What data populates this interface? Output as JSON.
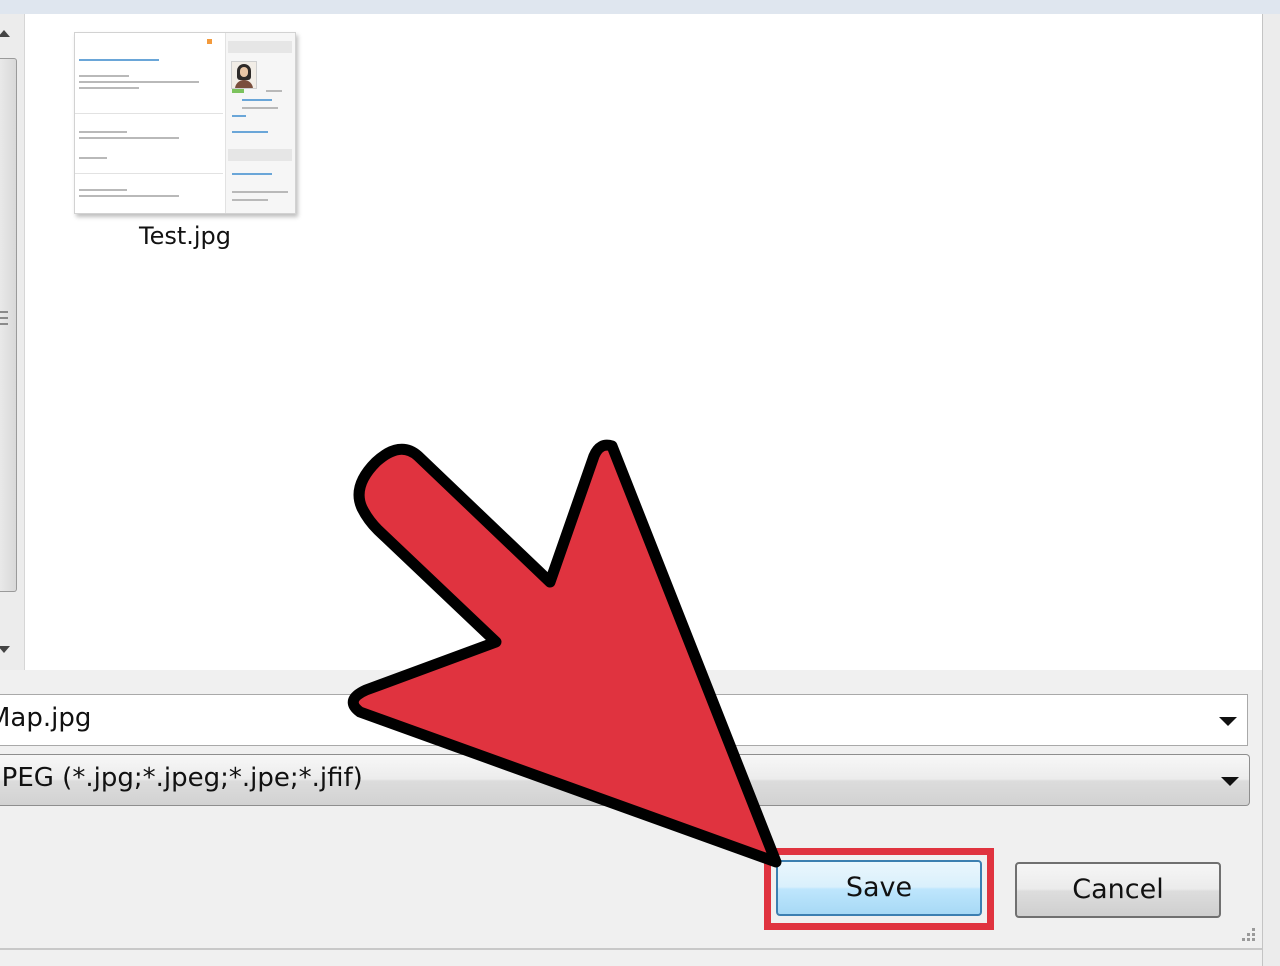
{
  "window": {
    "title_strip": ""
  },
  "file_pane": {
    "files": [
      {
        "name": "Test.jpg",
        "icon": "image-thumbnail-icon"
      }
    ]
  },
  "form": {
    "file_name_value": "Map.jpg",
    "file_type_value": "JPEG (*.jpg;*.jpeg;*.jpe;*.jfif)"
  },
  "buttons": {
    "save_label": "Save",
    "cancel_label": "Cancel"
  },
  "annotation": {
    "arrow_color": "#e0333f",
    "highlight_color": "#e0333f",
    "arrow_icon": "red-pointer-arrow-icon"
  },
  "colors": {
    "save_button_border": "#3c7fb1",
    "pane_background": "#ffffff",
    "dialog_background": "#f0f0f0"
  }
}
